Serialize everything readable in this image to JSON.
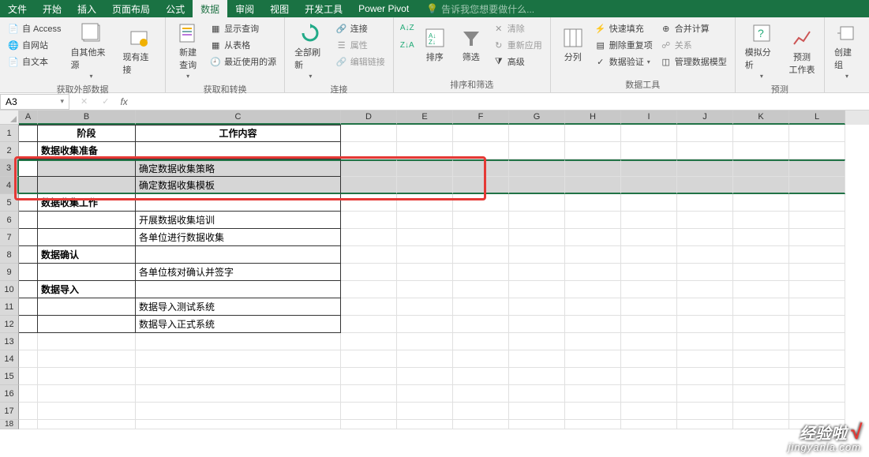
{
  "tabs": {
    "file": "文件",
    "home": "开始",
    "insert": "插入",
    "layout": "页面布局",
    "formula": "公式",
    "data": "数据",
    "review": "审阅",
    "view": "视图",
    "dev": "开发工具",
    "powerpivot": "Power Pivot"
  },
  "tellme": {
    "placeholder": "告诉我您想要做什么..."
  },
  "ribbon": {
    "g1": {
      "access": "自 Access",
      "web": "自网站",
      "text": "自文本",
      "other": "自其他来源",
      "existing": "现有连接",
      "label": "获取外部数据"
    },
    "g2": {
      "newquery": "新建\n查询",
      "show": "显示查询",
      "fromtable": "从表格",
      "recent": "最近使用的源",
      "label": "获取和转换"
    },
    "g3": {
      "refresh": "全部刷新",
      "conn": "连接",
      "prop": "属性",
      "editlink": "编辑链接",
      "label": "连接"
    },
    "g4": {
      "sort": "排序",
      "filter": "筛选",
      "clear": "清除",
      "reapply": "重新应用",
      "advanced": "高级",
      "label": "排序和筛选"
    },
    "g5": {
      "tocol": "分列",
      "flash": "快速填充",
      "dup": "删除重复项",
      "valid": "数据验证",
      "consol": "合并计算",
      "rel": "关系",
      "model": "管理数据模型",
      "label": "数据工具"
    },
    "g6": {
      "whatif": "模拟分析",
      "forecast": "预测\n工作表",
      "label": "预测"
    },
    "g7": {
      "group": "创建组",
      "label": ""
    }
  },
  "namebox": "A3",
  "fx": "fx",
  "cols": [
    "A",
    "B",
    "C",
    "D",
    "E",
    "F",
    "G",
    "H",
    "I",
    "J",
    "K",
    "L"
  ],
  "rowdata": {
    "r1": {
      "B": "阶段",
      "C": "工作内容"
    },
    "r2": {
      "B": "数据收集准备"
    },
    "r3": {
      "C": "确定数据收集策略"
    },
    "r4": {
      "C": "确定数据收集模板"
    },
    "r5": {
      "B": "数据收集工作"
    },
    "r6": {
      "C": "开展数据收集培训"
    },
    "r7": {
      "C": "各单位进行数据收集"
    },
    "r8": {
      "B": "数据确认"
    },
    "r9": {
      "C": "各单位核对确认并签字"
    },
    "r10": {
      "B": "数据导入"
    },
    "r11": {
      "C": "数据导入测试系统"
    },
    "r12": {
      "C": "数据导入正式系统"
    }
  },
  "rownums": [
    "1",
    "2",
    "3",
    "4",
    "5",
    "6",
    "7",
    "8",
    "9",
    "10",
    "11",
    "12",
    "13",
    "14",
    "15",
    "16",
    "17",
    "18"
  ],
  "watermark": {
    "main": "经验啦",
    "check": "√",
    "sub": "jingyanla.com"
  }
}
